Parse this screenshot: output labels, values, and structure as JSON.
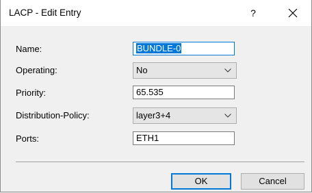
{
  "window": {
    "title": "LACP - Edit Entry",
    "help_glyph": "?",
    "close_icon": "close-icon"
  },
  "form": {
    "name": {
      "label": "Name:",
      "value": "BUNDLE-0"
    },
    "operating": {
      "label": "Operating:",
      "value": "No"
    },
    "priority": {
      "label": "Priority:",
      "value": "65.535"
    },
    "distribution_policy": {
      "label": "Distribution-Policy:",
      "value": "layer3+4"
    },
    "ports": {
      "label": "Ports:",
      "value": "ETH1"
    }
  },
  "buttons": {
    "ok": "OK",
    "cancel": "Cancel"
  },
  "colors": {
    "accent": "#0078d7",
    "background": "#f0f0f0"
  }
}
